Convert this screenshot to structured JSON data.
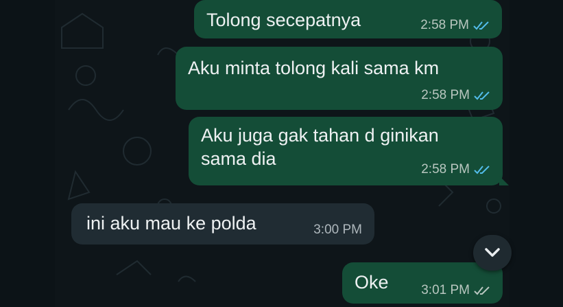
{
  "colors": {
    "outgoing_bubble": "#144d37",
    "incoming_bubble": "#202c33",
    "read_tick": "#53bdeb",
    "delivered_tick": "#b9c7c0",
    "background": "#0b1014"
  },
  "messages": [
    {
      "direction": "out",
      "text": "Tolong secepatnya",
      "time": "2:58 PM",
      "status": "read"
    },
    {
      "direction": "out",
      "text": "Aku minta tolong kali sama km",
      "time": "2:58 PM",
      "status": "read"
    },
    {
      "direction": "out",
      "text": "Aku juga gak tahan d ginikan\nsama dia",
      "time": "2:58 PM",
      "status": "read"
    },
    {
      "direction": "in",
      "text": "ini aku mau ke polda",
      "time": "3:00 PM"
    },
    {
      "direction": "out",
      "text": "Oke",
      "time": "3:01 PM",
      "status": "delivered"
    }
  ],
  "scroll_button": {
    "icon": "chevron-down-icon"
  }
}
